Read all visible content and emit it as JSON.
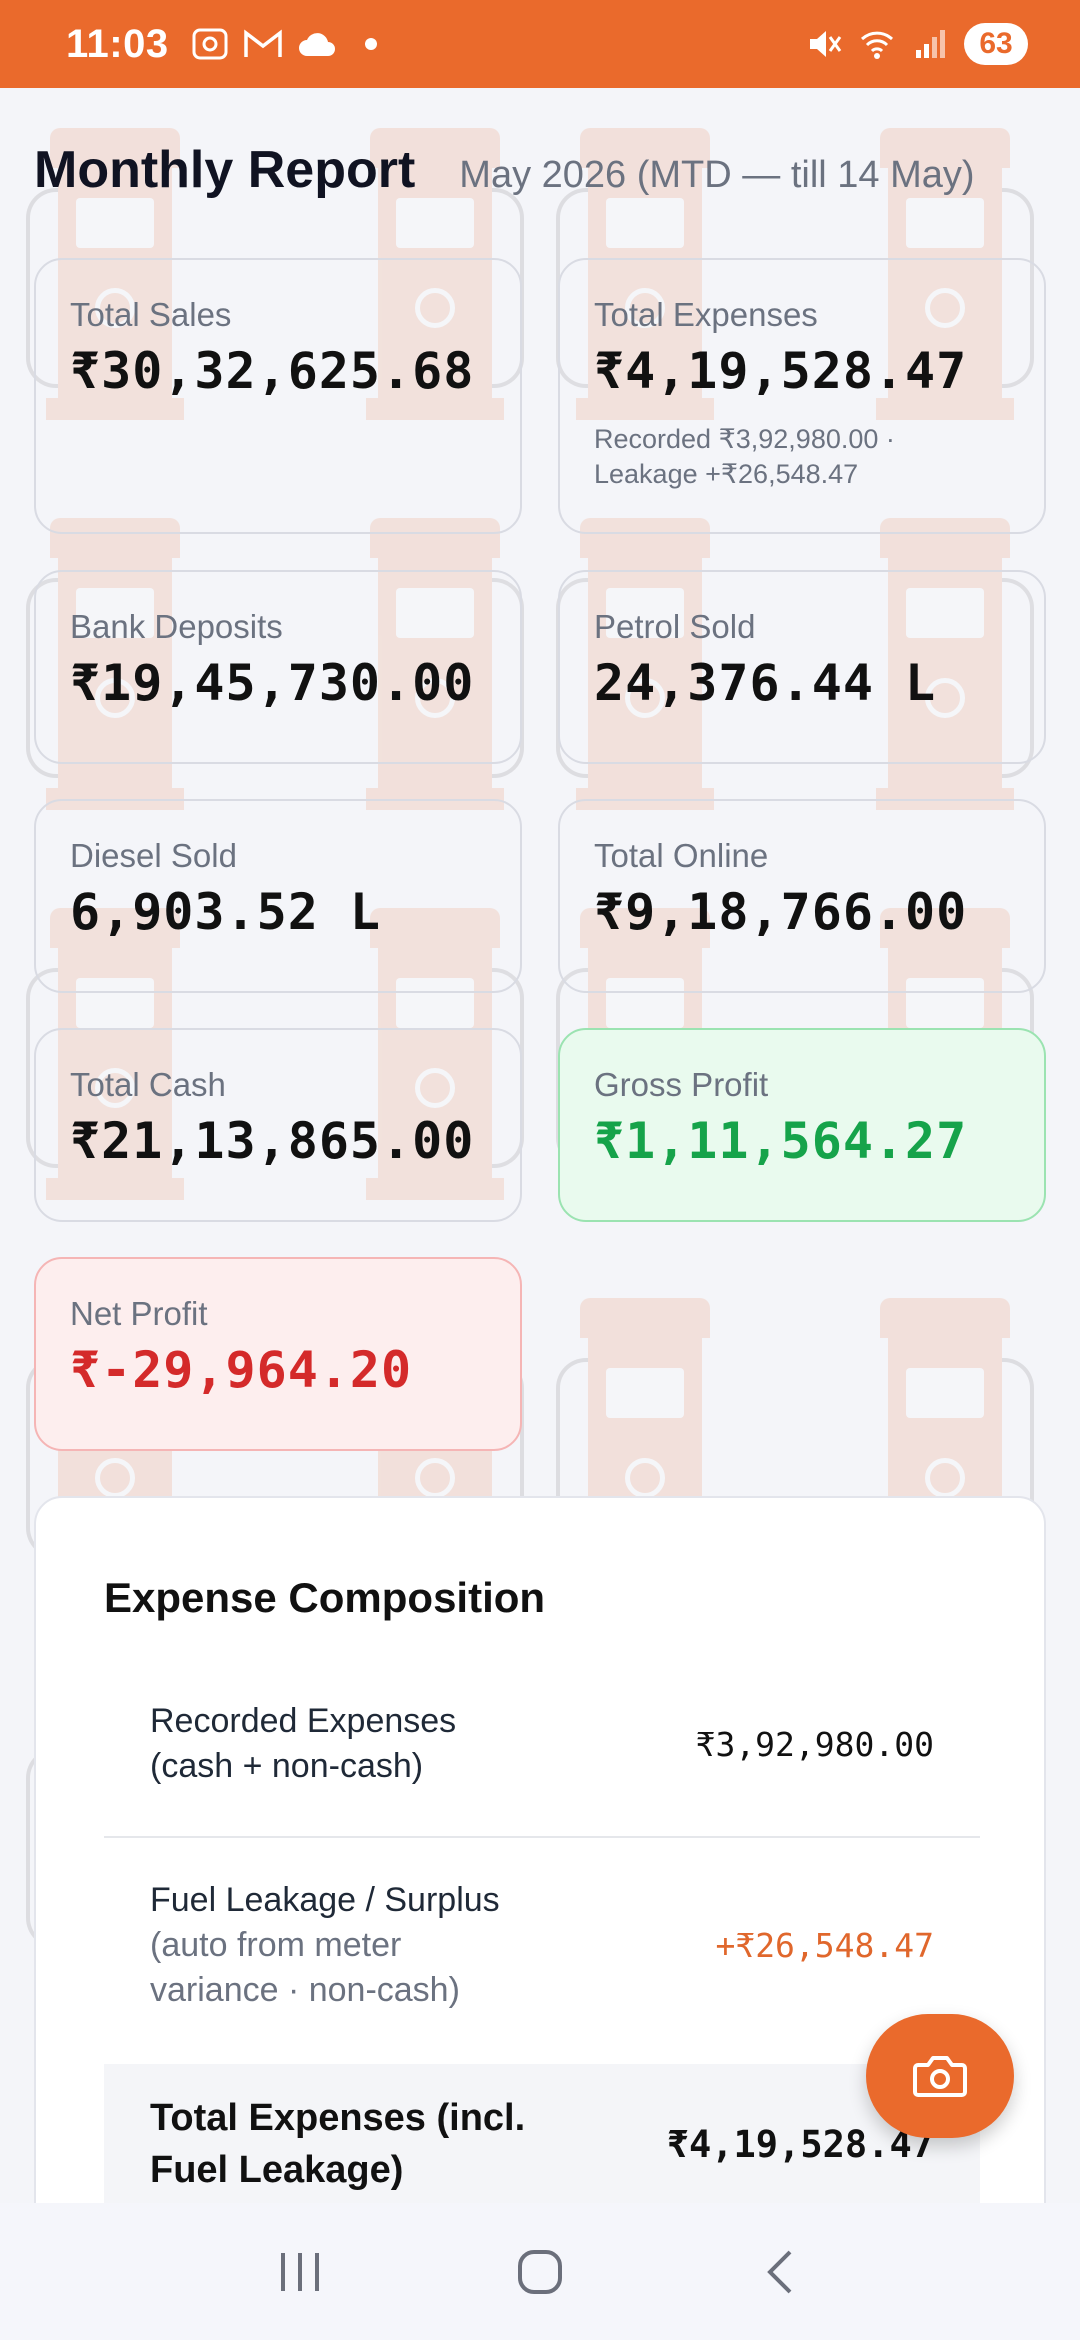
{
  "status_bar": {
    "time": "11:03",
    "battery": "63",
    "icons": [
      "screenshot-icon",
      "gmail-icon",
      "cloud-icon",
      "notification-dot",
      "mute-icon",
      "wifi-icon",
      "signal-icon",
      "battery-icon"
    ]
  },
  "header": {
    "title": "Monthly Report",
    "subtitle": "May 2026 (MTD — till 14 May)"
  },
  "cards": {
    "total_sales": {
      "label": "Total Sales",
      "value": "₹30,32,625.68"
    },
    "total_expenses": {
      "label": "Total Expenses",
      "value": "₹4,19,528.47",
      "note_line1": "Recorded ₹3,92,980.00 ·",
      "note_line2": "Leakage +₹26,548.47"
    },
    "bank_deposits": {
      "label": "Bank Deposits",
      "value": "₹19,45,730.00"
    },
    "petrol_sold": {
      "label": "Petrol Sold",
      "value": "24,376.44 L"
    },
    "diesel_sold": {
      "label": "Diesel Sold",
      "value": "6,903.52 L"
    },
    "total_online": {
      "label": "Total Online",
      "value": "₹9,18,766.00"
    },
    "total_cash": {
      "label": "Total Cash",
      "value": "₹21,13,865.00"
    },
    "gross_profit": {
      "label": "Gross Profit",
      "value": "₹1,11,564.27"
    },
    "net_profit": {
      "label": "Net Profit",
      "value": "₹-29,964.20"
    }
  },
  "colors": {
    "accent": "#ea6a2c",
    "positive": "#16a34a",
    "negative": "#d42a2a"
  },
  "expense_composition": {
    "title": "Expense Composition",
    "recorded": {
      "line1": "Recorded Expenses",
      "line2": "(cash + non-cash)",
      "amount": "₹3,92,980.00"
    },
    "leakage": {
      "line1": "Fuel Leakage / Surplus",
      "line2": "(auto from meter",
      "line3": "variance · non-cash)",
      "amount": "+₹26,548.47"
    },
    "total": {
      "line1": "Total Expenses (incl.",
      "line2": "Fuel Leakage)",
      "amount": "₹4,19,528.47"
    }
  },
  "fab": {
    "icon": "camera-icon"
  },
  "nav": {
    "icons": [
      "recents-icon",
      "home-icon",
      "back-icon"
    ]
  }
}
